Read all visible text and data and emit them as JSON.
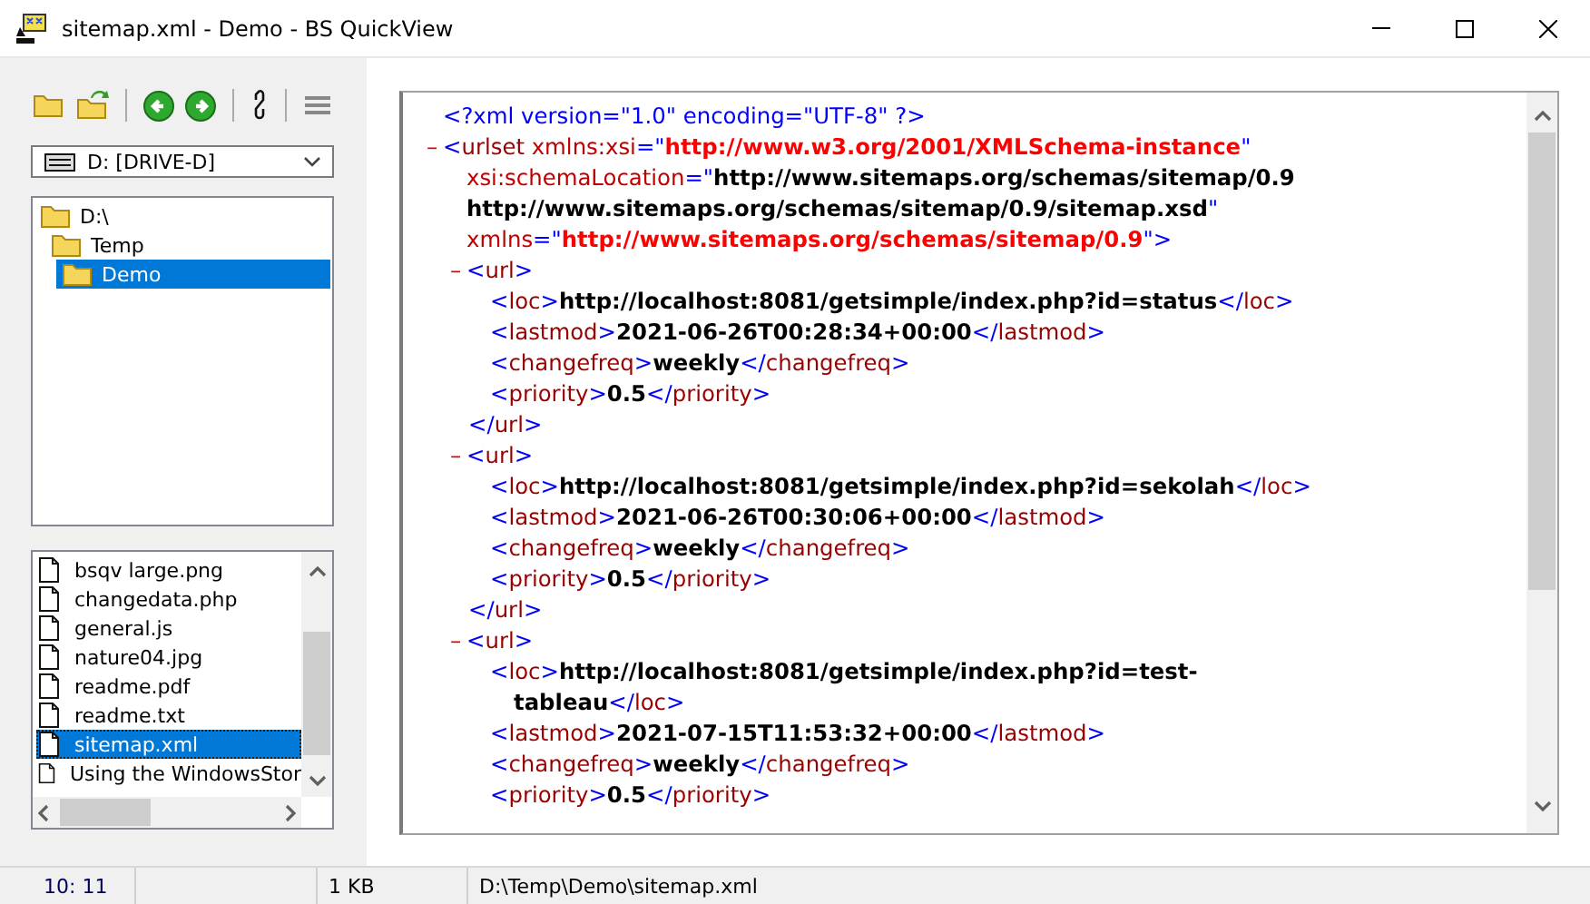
{
  "window": {
    "title": "sitemap.xml - Demo - BS QuickView"
  },
  "drive": {
    "value": "D: [DRIVE-D]"
  },
  "folders": [
    {
      "label": "D:\\",
      "selected": false,
      "children": [
        {
          "label": "Temp",
          "selected": false,
          "children": [
            {
              "label": "Demo",
              "selected": true
            }
          ]
        }
      ]
    }
  ],
  "files": [
    {
      "name": "bsqv large.png",
      "selected": false
    },
    {
      "name": "changedata.php",
      "selected": false
    },
    {
      "name": "general.js",
      "selected": false
    },
    {
      "name": "nature04.jpg",
      "selected": false
    },
    {
      "name": "readme.pdf",
      "selected": false
    },
    {
      "name": "readme.txt",
      "selected": false
    },
    {
      "name": "sitemap.xml",
      "selected": true
    },
    {
      "name": "Using the WindowsStor",
      "selected": false
    }
  ],
  "document": [
    {
      "kind": "pi",
      "lines": [
        [
          {
            "kind": "punct",
            "text": "<?xml version=\"1.0\" encoding=\"UTF-8\" ?>"
          }
        ]
      ]
    },
    {
      "kind": "element",
      "toggle": "–",
      "expanded": true,
      "lines": [
        [
          {
            "kind": "punct",
            "text": "<"
          },
          {
            "kind": "tag",
            "text": "urlset"
          },
          {
            "kind": "attr",
            "text": " xmlns:xsi"
          },
          {
            "kind": "punct",
            "text": "=\""
          },
          {
            "kind": "value",
            "text": "http://www.w3.org/2001/XMLSchema-instance"
          },
          {
            "kind": "punct",
            "text": "\""
          }
        ],
        [
          {
            "kind": "attr",
            "text": "xsi:schemaLocation"
          },
          {
            "kind": "punct",
            "text": "=\""
          },
          {
            "kind": "text",
            "text": "http://www.sitemaps.org/schemas/sitemap/0.9"
          }
        ],
        [
          {
            "kind": "text",
            "text": "http://www.sitemaps.org/schemas/sitemap/0.9/sitemap.xsd"
          },
          {
            "kind": "punct",
            "text": "\""
          }
        ],
        [
          {
            "kind": "attr",
            "text": "xmlns"
          },
          {
            "kind": "punct",
            "text": "=\""
          },
          {
            "kind": "value",
            "text": "http://www.sitemaps.org/schemas/sitemap/0.9"
          },
          {
            "kind": "punct",
            "text": "\">"
          }
        ]
      ],
      "children": [
        {
          "kind": "element",
          "toggle": "–",
          "expanded": true,
          "lines": [
            [
              {
                "kind": "punct",
                "text": "<"
              },
              {
                "kind": "tag",
                "text": "url"
              },
              {
                "kind": "punct",
                "text": ">"
              }
            ]
          ],
          "children": [
            {
              "kind": "leaf",
              "lines": [
                [
                  {
                    "kind": "punct",
                    "text": "<"
                  },
                  {
                    "kind": "tag",
                    "text": "loc"
                  },
                  {
                    "kind": "punct",
                    "text": ">"
                  },
                  {
                    "kind": "text",
                    "text": "http://localhost:8081/getsimple/index.php?id=status"
                  },
                  {
                    "kind": "punct",
                    "text": "</"
                  },
                  {
                    "kind": "tag",
                    "text": "loc"
                  },
                  {
                    "kind": "punct",
                    "text": ">"
                  }
                ]
              ]
            },
            {
              "kind": "leaf",
              "lines": [
                [
                  {
                    "kind": "punct",
                    "text": "<"
                  },
                  {
                    "kind": "tag",
                    "text": "lastmod"
                  },
                  {
                    "kind": "punct",
                    "text": ">"
                  },
                  {
                    "kind": "text",
                    "text": "2021-06-26T00:28:34+00:00"
                  },
                  {
                    "kind": "punct",
                    "text": "</"
                  },
                  {
                    "kind": "tag",
                    "text": "lastmod"
                  },
                  {
                    "kind": "punct",
                    "text": ">"
                  }
                ]
              ]
            },
            {
              "kind": "leaf",
              "lines": [
                [
                  {
                    "kind": "punct",
                    "text": "<"
                  },
                  {
                    "kind": "tag",
                    "text": "changefreq"
                  },
                  {
                    "kind": "punct",
                    "text": ">"
                  },
                  {
                    "kind": "text",
                    "text": "weekly"
                  },
                  {
                    "kind": "punct",
                    "text": "</"
                  },
                  {
                    "kind": "tag",
                    "text": "changefreq"
                  },
                  {
                    "kind": "punct",
                    "text": ">"
                  }
                ]
              ]
            },
            {
              "kind": "leaf",
              "lines": [
                [
                  {
                    "kind": "punct",
                    "text": "<"
                  },
                  {
                    "kind": "tag",
                    "text": "priority"
                  },
                  {
                    "kind": "punct",
                    "text": ">"
                  },
                  {
                    "kind": "text",
                    "text": "0.5"
                  },
                  {
                    "kind": "punct",
                    "text": "</"
                  },
                  {
                    "kind": "tag",
                    "text": "priority"
                  },
                  {
                    "kind": "punct",
                    "text": ">"
                  }
                ]
              ]
            }
          ],
          "close": [
            {
              "kind": "punct",
              "text": "</"
            },
            {
              "kind": "tag",
              "text": "url"
            },
            {
              "kind": "punct",
              "text": ">"
            }
          ]
        },
        {
          "kind": "element",
          "toggle": "–",
          "expanded": true,
          "lines": [
            [
              {
                "kind": "punct",
                "text": "<"
              },
              {
                "kind": "tag",
                "text": "url"
              },
              {
                "kind": "punct",
                "text": ">"
              }
            ]
          ],
          "children": [
            {
              "kind": "leaf",
              "lines": [
                [
                  {
                    "kind": "punct",
                    "text": "<"
                  },
                  {
                    "kind": "tag",
                    "text": "loc"
                  },
                  {
                    "kind": "punct",
                    "text": ">"
                  },
                  {
                    "kind": "text",
                    "text": "http://localhost:8081/getsimple/index.php?id=sekolah"
                  },
                  {
                    "kind": "punct",
                    "text": "</"
                  },
                  {
                    "kind": "tag",
                    "text": "loc"
                  },
                  {
                    "kind": "punct",
                    "text": ">"
                  }
                ]
              ]
            },
            {
              "kind": "leaf",
              "lines": [
                [
                  {
                    "kind": "punct",
                    "text": "<"
                  },
                  {
                    "kind": "tag",
                    "text": "lastmod"
                  },
                  {
                    "kind": "punct",
                    "text": ">"
                  },
                  {
                    "kind": "text",
                    "text": "2021-06-26T00:30:06+00:00"
                  },
                  {
                    "kind": "punct",
                    "text": "</"
                  },
                  {
                    "kind": "tag",
                    "text": "lastmod"
                  },
                  {
                    "kind": "punct",
                    "text": ">"
                  }
                ]
              ]
            },
            {
              "kind": "leaf",
              "lines": [
                [
                  {
                    "kind": "punct",
                    "text": "<"
                  },
                  {
                    "kind": "tag",
                    "text": "changefreq"
                  },
                  {
                    "kind": "punct",
                    "text": ">"
                  },
                  {
                    "kind": "text",
                    "text": "weekly"
                  },
                  {
                    "kind": "punct",
                    "text": "</"
                  },
                  {
                    "kind": "tag",
                    "text": "changefreq"
                  },
                  {
                    "kind": "punct",
                    "text": ">"
                  }
                ]
              ]
            },
            {
              "kind": "leaf",
              "lines": [
                [
                  {
                    "kind": "punct",
                    "text": "<"
                  },
                  {
                    "kind": "tag",
                    "text": "priority"
                  },
                  {
                    "kind": "punct",
                    "text": ">"
                  },
                  {
                    "kind": "text",
                    "text": "0.5"
                  },
                  {
                    "kind": "punct",
                    "text": "</"
                  },
                  {
                    "kind": "tag",
                    "text": "priority"
                  },
                  {
                    "kind": "punct",
                    "text": ">"
                  }
                ]
              ]
            }
          ],
          "close": [
            {
              "kind": "punct",
              "text": "</"
            },
            {
              "kind": "tag",
              "text": "url"
            },
            {
              "kind": "punct",
              "text": ">"
            }
          ]
        },
        {
          "kind": "element",
          "toggle": "–",
          "expanded": true,
          "lines": [
            [
              {
                "kind": "punct",
                "text": "<"
              },
              {
                "kind": "tag",
                "text": "url"
              },
              {
                "kind": "punct",
                "text": ">"
              }
            ]
          ],
          "children": [
            {
              "kind": "leaf",
              "lines": [
                [
                  {
                    "kind": "punct",
                    "text": "<"
                  },
                  {
                    "kind": "tag",
                    "text": "loc"
                  },
                  {
                    "kind": "punct",
                    "text": ">"
                  },
                  {
                    "kind": "text",
                    "text": "http://localhost:8081/getsimple/index.php?id=test-"
                  }
                ],
                [
                  {
                    "kind": "text",
                    "text": "tableau"
                  },
                  {
                    "kind": "punct",
                    "text": "</"
                  },
                  {
                    "kind": "tag",
                    "text": "loc"
                  },
                  {
                    "kind": "punct",
                    "text": ">"
                  }
                ]
              ]
            },
            {
              "kind": "leaf",
              "lines": [
                [
                  {
                    "kind": "punct",
                    "text": "<"
                  },
                  {
                    "kind": "tag",
                    "text": "lastmod"
                  },
                  {
                    "kind": "punct",
                    "text": ">"
                  },
                  {
                    "kind": "text",
                    "text": "2021-07-15T11:53:32+00:00"
                  },
                  {
                    "kind": "punct",
                    "text": "</"
                  },
                  {
                    "kind": "tag",
                    "text": "lastmod"
                  },
                  {
                    "kind": "punct",
                    "text": ">"
                  }
                ]
              ]
            },
            {
              "kind": "leaf",
              "lines": [
                [
                  {
                    "kind": "punct",
                    "text": "<"
                  },
                  {
                    "kind": "tag",
                    "text": "changefreq"
                  },
                  {
                    "kind": "punct",
                    "text": ">"
                  },
                  {
                    "kind": "text",
                    "text": "weekly"
                  },
                  {
                    "kind": "punct",
                    "text": "</"
                  },
                  {
                    "kind": "tag",
                    "text": "changefreq"
                  },
                  {
                    "kind": "punct",
                    "text": ">"
                  }
                ]
              ]
            },
            {
              "kind": "leaf",
              "lines": [
                [
                  {
                    "kind": "punct",
                    "text": "<"
                  },
                  {
                    "kind": "tag",
                    "text": "priority"
                  },
                  {
                    "kind": "punct",
                    "text": ">"
                  },
                  {
                    "kind": "text",
                    "text": "0.5"
                  },
                  {
                    "kind": "punct",
                    "text": "</"
                  },
                  {
                    "kind": "tag",
                    "text": "priority"
                  },
                  {
                    "kind": "punct",
                    "text": ">"
                  }
                ]
              ]
            }
          ]
        }
      ]
    }
  ],
  "status_bar": {
    "position": "10: 11",
    "size": "1 KB",
    "path": "D:\\Temp\\Demo\\sitemap.xml"
  }
}
